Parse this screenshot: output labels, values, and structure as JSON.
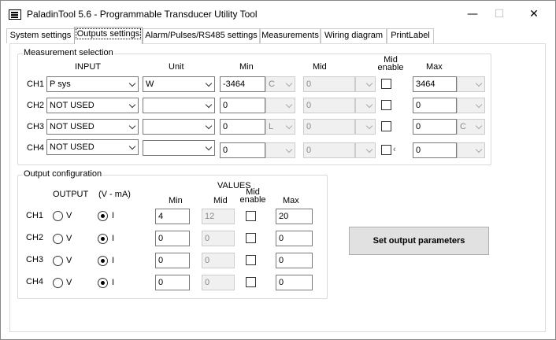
{
  "window": {
    "title": "PaladinTool  5.6 -  Programmable Transducer Utility Tool",
    "min": "—",
    "max": "☐",
    "close": "✕"
  },
  "tabs": [
    "System settings",
    "Outputs settings",
    "Alarm/Pulses/RS485 settings",
    "Measurements",
    "Wiring diagram",
    "PrintLabel"
  ],
  "measurement": {
    "title": "Measurement selection",
    "headers": {
      "input": "INPUT",
      "unit": "Unit",
      "min": "Min",
      "mid": "Mid",
      "mid_enable": "Mid enable",
      "max": "Max"
    },
    "rows": [
      {
        "ch": "CH1",
        "input": "P sys",
        "unit": "W",
        "min": "-3464",
        "min_unit": "C",
        "mid": "0",
        "mid_unit": "",
        "max": "3464",
        "max_unit": ""
      },
      {
        "ch": "CH2",
        "input": "NOT USED",
        "unit": "",
        "min": "0",
        "min_unit": "",
        "mid": "0",
        "mid_unit": "",
        "max": "0",
        "max_unit": ""
      },
      {
        "ch": "CH3",
        "input": "NOT USED",
        "unit": "",
        "min": "0",
        "min_unit": "L",
        "mid": "0",
        "mid_unit": "",
        "max": "0",
        "max_unit": "C"
      },
      {
        "ch": "CH4",
        "input": "NOT USED",
        "unit": "",
        "min": "0",
        "min_unit": "",
        "mid": "0",
        "mid_unit": "",
        "max": "0",
        "max_unit": "",
        "mid_extra": "‹"
      }
    ]
  },
  "output": {
    "title": "Output configuration",
    "headers": {
      "output": "OUTPUT",
      "vma": "(V - mA)",
      "values": "VALUES",
      "min": "Min",
      "mid": "Mid",
      "mid_enable": "Mid enable",
      "max": "Max"
    },
    "radio_v": "V",
    "radio_i": "I",
    "rows": [
      {
        "ch": "CH1",
        "min": "4",
        "mid": "12",
        "max": "20"
      },
      {
        "ch": "CH2",
        "min": "0",
        "mid": "0",
        "max": "0"
      },
      {
        "ch": "CH3",
        "min": "0",
        "mid": "0",
        "max": "0"
      },
      {
        "ch": "CH4",
        "min": "0",
        "mid": "0",
        "max": "0"
      }
    ]
  },
  "set_button": "Set output parameters"
}
